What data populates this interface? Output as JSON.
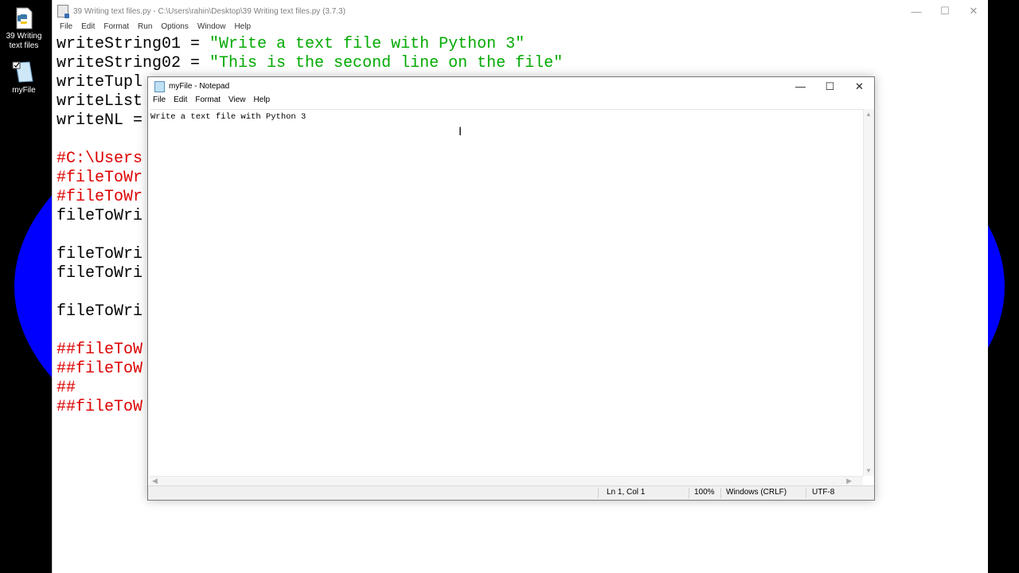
{
  "desktop": {
    "icons": [
      {
        "label_line1": "39 Writing",
        "label_line2": "text files",
        "icon": "python-file-icon"
      },
      {
        "label_line1": "myFile",
        "label_line2": "",
        "icon": "text-file-icon"
      }
    ]
  },
  "idle": {
    "title": "39 Writing text files.py - C:\\Users\\rahin\\Desktop\\39 Writing text files.py (3.7.3)",
    "menu": [
      "File",
      "Edit",
      "Format",
      "Run",
      "Options",
      "Window",
      "Help"
    ],
    "code": [
      {
        "a": "writeString01 = ",
        "b": "\"Write a text file with Python 3\"",
        "color": "green"
      },
      {
        "a": "writeString02 = ",
        "b": "\"This is the second line on the file\"",
        "color": "green"
      },
      {
        "a": "writeTupl",
        "b": "",
        "color": "black"
      },
      {
        "a": "writeList",
        "b": "",
        "color": "black"
      },
      {
        "a": "writeNL =",
        "b": "",
        "color": "black"
      },
      {
        "a": "",
        "b": "",
        "color": "black"
      },
      {
        "a": "#C:\\Users",
        "b": "",
        "color": "red"
      },
      {
        "a": "#fileToWr",
        "b": "",
        "color": "red"
      },
      {
        "a": "#fileToWr",
        "b": "",
        "color": "red"
      },
      {
        "a": "fileToWri",
        "b": "",
        "color": "black"
      },
      {
        "a": "",
        "b": "",
        "color": "black"
      },
      {
        "a": "fileToWri",
        "b": "",
        "color": "black"
      },
      {
        "a": "fileToWri",
        "b": "",
        "color": "black"
      },
      {
        "a": "",
        "b": "",
        "color": "black"
      },
      {
        "a": "fileToWri",
        "b": "",
        "color": "black"
      },
      {
        "a": "",
        "b": "",
        "color": "black"
      },
      {
        "a": "##fileToW",
        "b": "",
        "color": "red"
      },
      {
        "a": "##fileToW",
        "b": "",
        "color": "red"
      },
      {
        "a": "##",
        "b": "",
        "color": "red"
      },
      {
        "a": "##fileToW",
        "b": "",
        "color": "red"
      }
    ],
    "controls": {
      "minimize": "—",
      "maximize": "☐",
      "close": "✕"
    }
  },
  "notepad": {
    "title": "myFile - Notepad",
    "menu": [
      "File",
      "Edit",
      "Format",
      "View",
      "Help"
    ],
    "content": "Write a text file with Python 3",
    "controls": {
      "minimize": "—",
      "maximize": "☐",
      "close": "✕"
    },
    "status": {
      "position": "Ln 1, Col 1",
      "zoom": "100%",
      "line_endings": "Windows (CRLF)",
      "encoding": "UTF-8"
    }
  }
}
